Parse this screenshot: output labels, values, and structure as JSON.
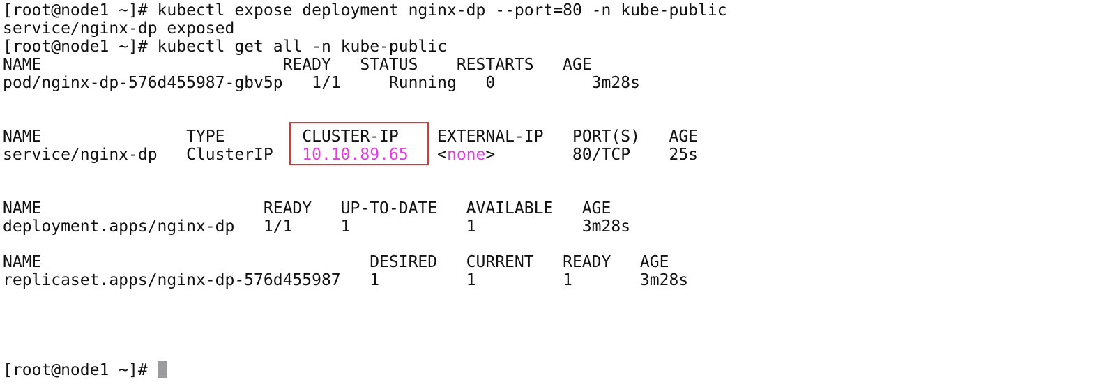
{
  "prompt": "[root@node1 ~]# ",
  "lines": {
    "cmd1": "[root@node1 ~]# kubectl expose deployment nginx-dp --port=80 -n kube-public",
    "out1": "service/nginx-dp exposed",
    "cmd2": "[root@node1 ~]# kubectl get all -n kube-public",
    "pod_header": "NAME                         READY   STATUS    RESTARTS   AGE",
    "pod_row": "pod/nginx-dp-576d455987-gbv5p   1/1     Running   0          3m28s",
    "svc_header_a": "NAME               TYPE        ",
    "svc_header_b": "CLUSTER-IP",
    "svc_header_c": "    EXTERNAL-IP   PORT(S)   AGE",
    "svc_row_a": "service/nginx-dp   ClusterIP   ",
    "svc_row_ip": "10.10.89.65",
    "svc_row_b": "   <",
    "svc_row_none": "none",
    "svc_row_c": ">        80/TCP    25s",
    "deploy_header": "NAME                       READY   UP-TO-DATE   AVAILABLE   AGE",
    "deploy_row": "deployment.apps/nginx-dp   1/1     1            1           3m28s",
    "rs_header": "NAME                                  DESIRED   CURRENT   READY   AGE",
    "rs_row": "replicaset.apps/nginx-dp-576d455987   1         1         1       3m28s"
  },
  "colors": {
    "background": "#ffffff",
    "text": "#111111",
    "highlight": "#e83be8",
    "box": "#d9383a",
    "cursor": "#9c9ca0"
  }
}
